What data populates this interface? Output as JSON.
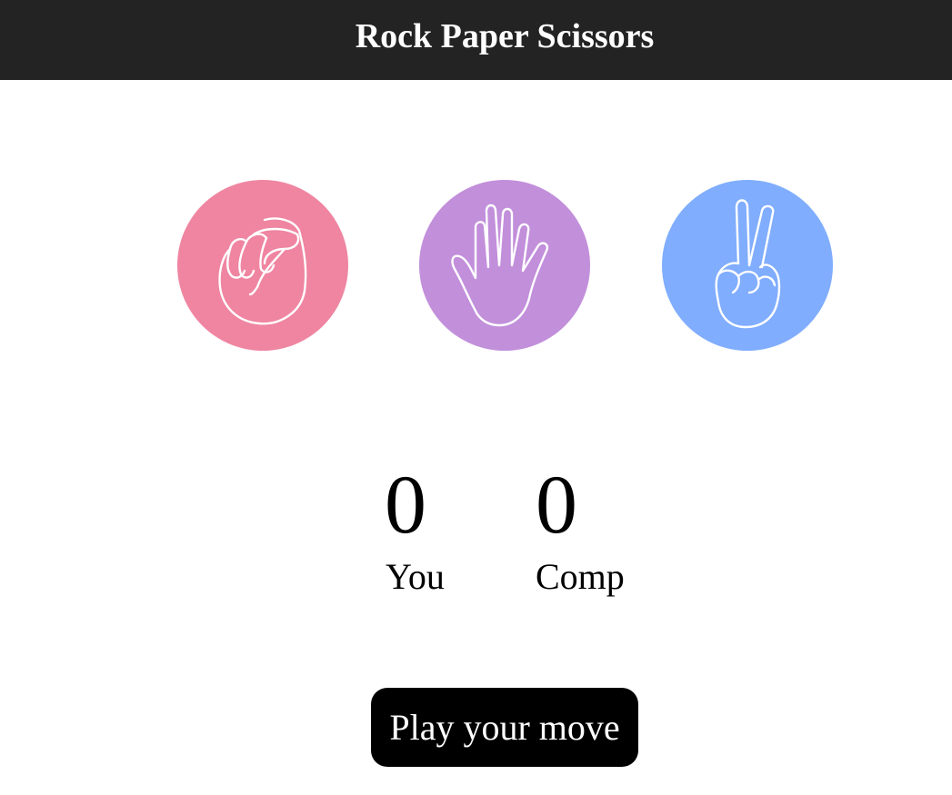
{
  "header": {
    "title": "Rock Paper Scissors",
    "background": "#232323"
  },
  "choices": [
    {
      "id": "rock",
      "icon": "fist-icon",
      "color": "#ef85a1"
    },
    {
      "id": "paper",
      "icon": "open-hand-icon",
      "color": "#c28fdb"
    },
    {
      "id": "scissors",
      "icon": "peace-sign-icon",
      "color": "#80adfd"
    }
  ],
  "score": {
    "user": {
      "value": "0",
      "label": "You"
    },
    "comp": {
      "value": "0",
      "label": "Comp"
    }
  },
  "play_button": {
    "label": "Play your move"
  }
}
